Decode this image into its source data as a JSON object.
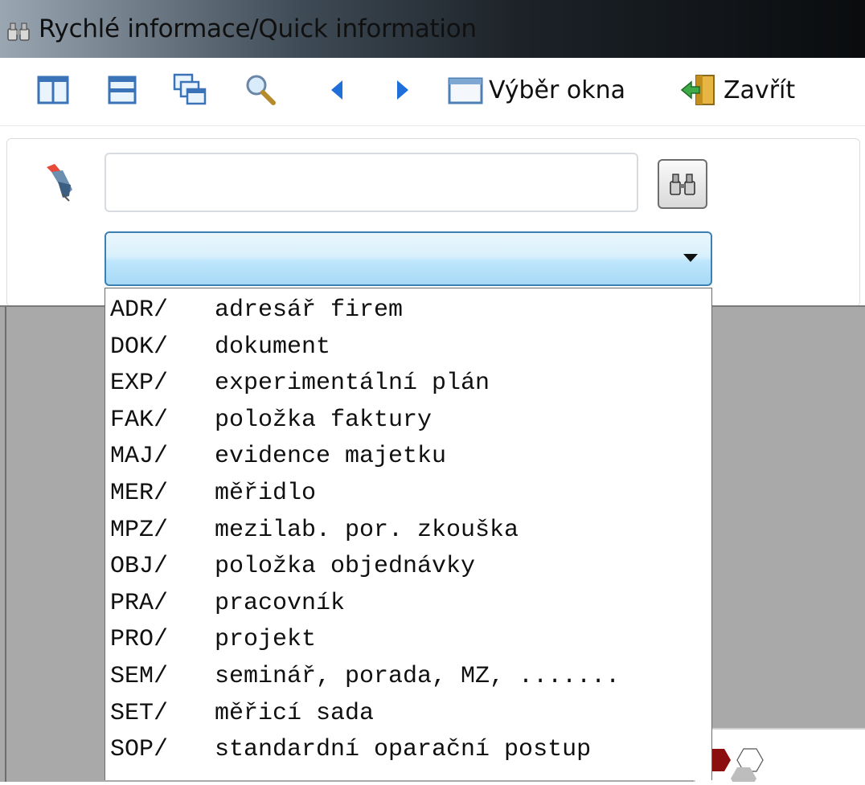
{
  "window": {
    "title": "Rychlé informace/Quick information"
  },
  "toolbar": {
    "icons": [
      "split-vertical-icon",
      "split-horizontal-icon",
      "cascade-windows-icon",
      "search-icon",
      "previous-arrow-icon",
      "next-arrow-icon"
    ],
    "window_select_label": "Výběr okna",
    "close_label": "Zavřít"
  },
  "search": {
    "value": "",
    "placeholder": ""
  },
  "combo": {
    "selected": ""
  },
  "dropdown": {
    "items": [
      {
        "code": "ADR/",
        "label": "adresář firem"
      },
      {
        "code": "DOK/",
        "label": "dokument"
      },
      {
        "code": "EXP/",
        "label": "experimentální plán"
      },
      {
        "code": "FAK/",
        "label": "položka faktury"
      },
      {
        "code": "MAJ/",
        "label": "evidence majetku"
      },
      {
        "code": "MER/",
        "label": "měřidlo"
      },
      {
        "code": "MPZ/",
        "label": "mezilab. por. zkouška"
      },
      {
        "code": "OBJ/",
        "label": "položka objednávky"
      },
      {
        "code": "PRA/",
        "label": "pracovník"
      },
      {
        "code": "PRO/",
        "label": "projekt"
      },
      {
        "code": "SEM/",
        "label": "seminář, porada, MZ, ......."
      },
      {
        "code": "SET/",
        "label": "měřicí sada"
      },
      {
        "code": "SOP/",
        "label": "standardní oparační postup"
      }
    ]
  },
  "colors": {
    "accent": "#3c7fb1",
    "logo_red": "#8b0f0f",
    "arrow_blue": "#1e6fd9"
  }
}
